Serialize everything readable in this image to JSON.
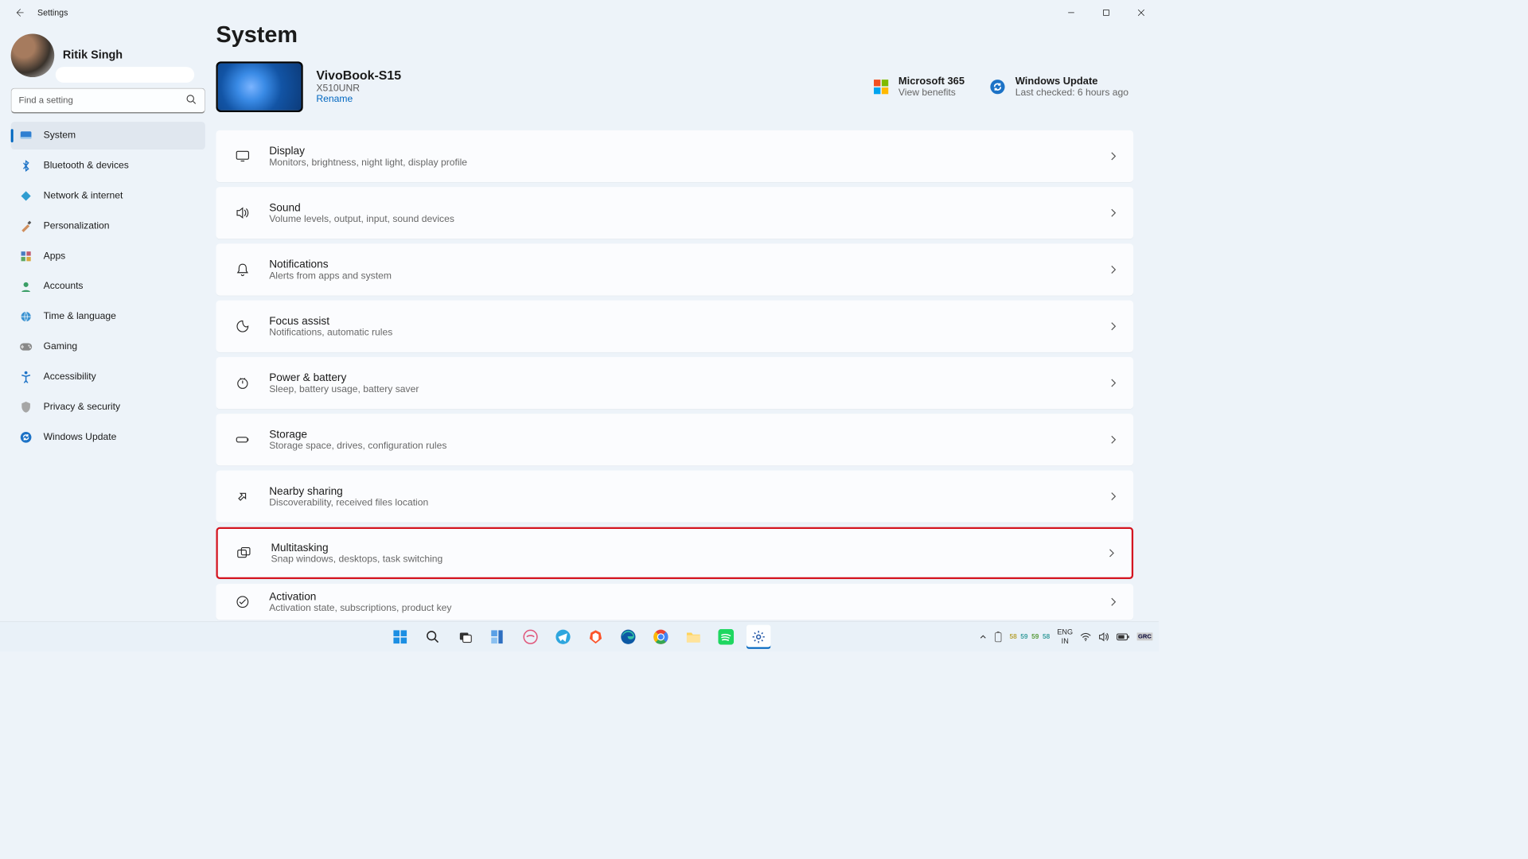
{
  "window": {
    "title": "Settings"
  },
  "user": {
    "name": "Ritik Singh"
  },
  "search": {
    "placeholder": "Find a setting"
  },
  "sidebar": {
    "items": [
      {
        "label": "System",
        "icon": "💻",
        "active": true
      },
      {
        "label": "Bluetooth & devices",
        "icon": "bt"
      },
      {
        "label": "Network & internet",
        "icon": "🔷"
      },
      {
        "label": "Personalization",
        "icon": "🖌️"
      },
      {
        "label": "Apps",
        "icon": "apps"
      },
      {
        "label": "Accounts",
        "icon": "👤"
      },
      {
        "label": "Time & language",
        "icon": "🌐"
      },
      {
        "label": "Gaming",
        "icon": "🎮"
      },
      {
        "label": "Accessibility",
        "icon": "acc"
      },
      {
        "label": "Privacy & security",
        "icon": "🛡️"
      },
      {
        "label": "Windows Update",
        "icon": "🔄"
      }
    ]
  },
  "page": {
    "title": "System"
  },
  "device": {
    "name": "VivoBook-S15",
    "model": "X510UNR",
    "rename": "Rename"
  },
  "rightCards": {
    "m365": {
      "title": "Microsoft 365",
      "sub": "View benefits"
    },
    "wu": {
      "title": "Windows Update",
      "sub": "Last checked: 6 hours ago"
    }
  },
  "systemList": [
    {
      "title": "Display",
      "sub": "Monitors, brightness, night light, display profile"
    },
    {
      "title": "Sound",
      "sub": "Volume levels, output, input, sound devices"
    },
    {
      "title": "Notifications",
      "sub": "Alerts from apps and system"
    },
    {
      "title": "Focus assist",
      "sub": "Notifications, automatic rules"
    },
    {
      "title": "Power & battery",
      "sub": "Sleep, battery usage, battery saver"
    },
    {
      "title": "Storage",
      "sub": "Storage space, drives, configuration rules"
    },
    {
      "title": "Nearby sharing",
      "sub": "Discoverability, received files location"
    },
    {
      "title": "Multitasking",
      "sub": "Snap windows, desktops, task switching",
      "highlight": true
    },
    {
      "title": "Activation",
      "sub": "Activation state, subscriptions, product key",
      "last": true
    }
  ],
  "taskbar": {
    "lang": {
      "top": "ENG",
      "bottom": "IN"
    },
    "cpu": [
      "58",
      "59",
      "59",
      "58"
    ]
  }
}
